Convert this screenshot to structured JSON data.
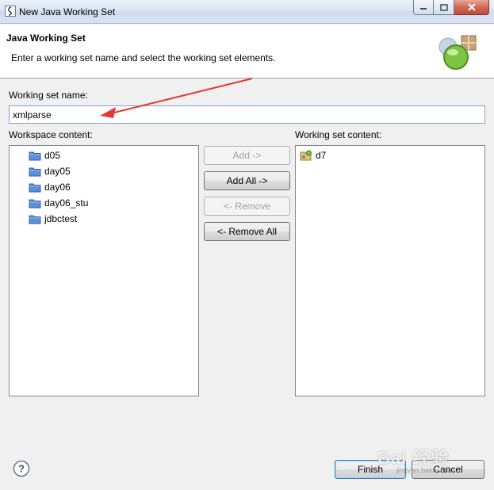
{
  "window": {
    "title": "New Java Working Set"
  },
  "header": {
    "title": "Java Working Set",
    "description": "Enter a working set name and select the working set elements."
  },
  "name_field": {
    "label": "Working set name:",
    "value": "xmlparse"
  },
  "workspace": {
    "label": "Workspace content:",
    "items": [
      "d05",
      "day05",
      "day06",
      "day06_stu",
      "jdbctest"
    ]
  },
  "working_set": {
    "label": "Working set content:",
    "items": [
      "d7"
    ]
  },
  "buttons": {
    "add": "Add ->",
    "add_all": "Add All ->",
    "remove": "<- Remove",
    "remove_all": "<- Remove All",
    "finish": "Finish",
    "cancel": "Cancel"
  },
  "watermark": {
    "text": "Bai 经验",
    "sub": "jingyan.baidu.com"
  },
  "colors": {
    "annotation_arrow": "#e53935",
    "folder": "#5b8fd6"
  }
}
